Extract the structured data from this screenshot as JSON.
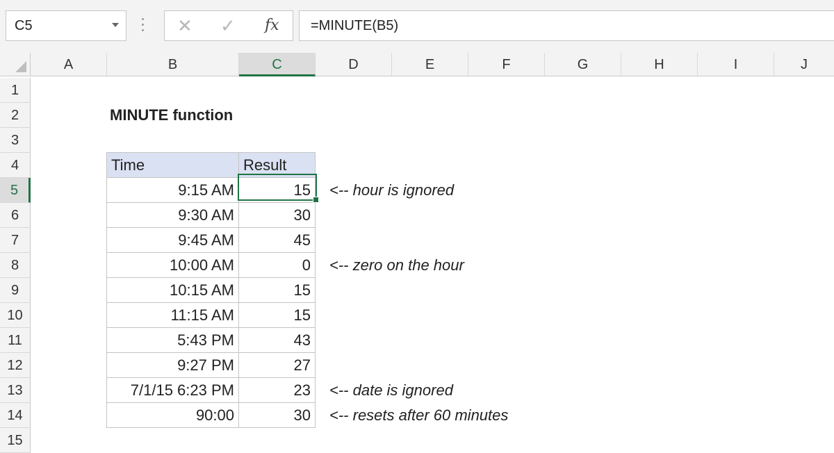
{
  "name_box": "C5",
  "formula": "=MINUTE(B5)",
  "fx_label": "fx",
  "columns": [
    "A",
    "B",
    "C",
    "D",
    "E",
    "F",
    "G",
    "H",
    "I",
    "J"
  ],
  "rows": [
    "1",
    "2",
    "3",
    "4",
    "5",
    "6",
    "7",
    "8",
    "9",
    "10",
    "11",
    "12",
    "13",
    "14",
    "15"
  ],
  "title": "MINUTE function",
  "table": {
    "headers": [
      "Time",
      "Result"
    ],
    "rows": [
      {
        "time": "9:15 AM",
        "result": "15",
        "note": "<-- hour is ignored"
      },
      {
        "time": "9:30 AM",
        "result": "30",
        "note": ""
      },
      {
        "time": "9:45 AM",
        "result": "45",
        "note": ""
      },
      {
        "time": "10:00 AM",
        "result": "0",
        "note": "<-- zero on the hour"
      },
      {
        "time": "10:15 AM",
        "result": "15",
        "note": ""
      },
      {
        "time": "11:15 AM",
        "result": "15",
        "note": ""
      },
      {
        "time": "5:43 PM",
        "result": "43",
        "note": ""
      },
      {
        "time": "9:27 PM",
        "result": "27",
        "note": ""
      },
      {
        "time": "7/1/15 6:23 PM",
        "result": "23",
        "note": "<-- date is ignored"
      },
      {
        "time": "90:00",
        "result": "30",
        "note": "<-- resets after 60 minutes"
      }
    ]
  },
  "colors": {
    "accent": "#217346",
    "table_header_fill": "#d9e1f2"
  }
}
